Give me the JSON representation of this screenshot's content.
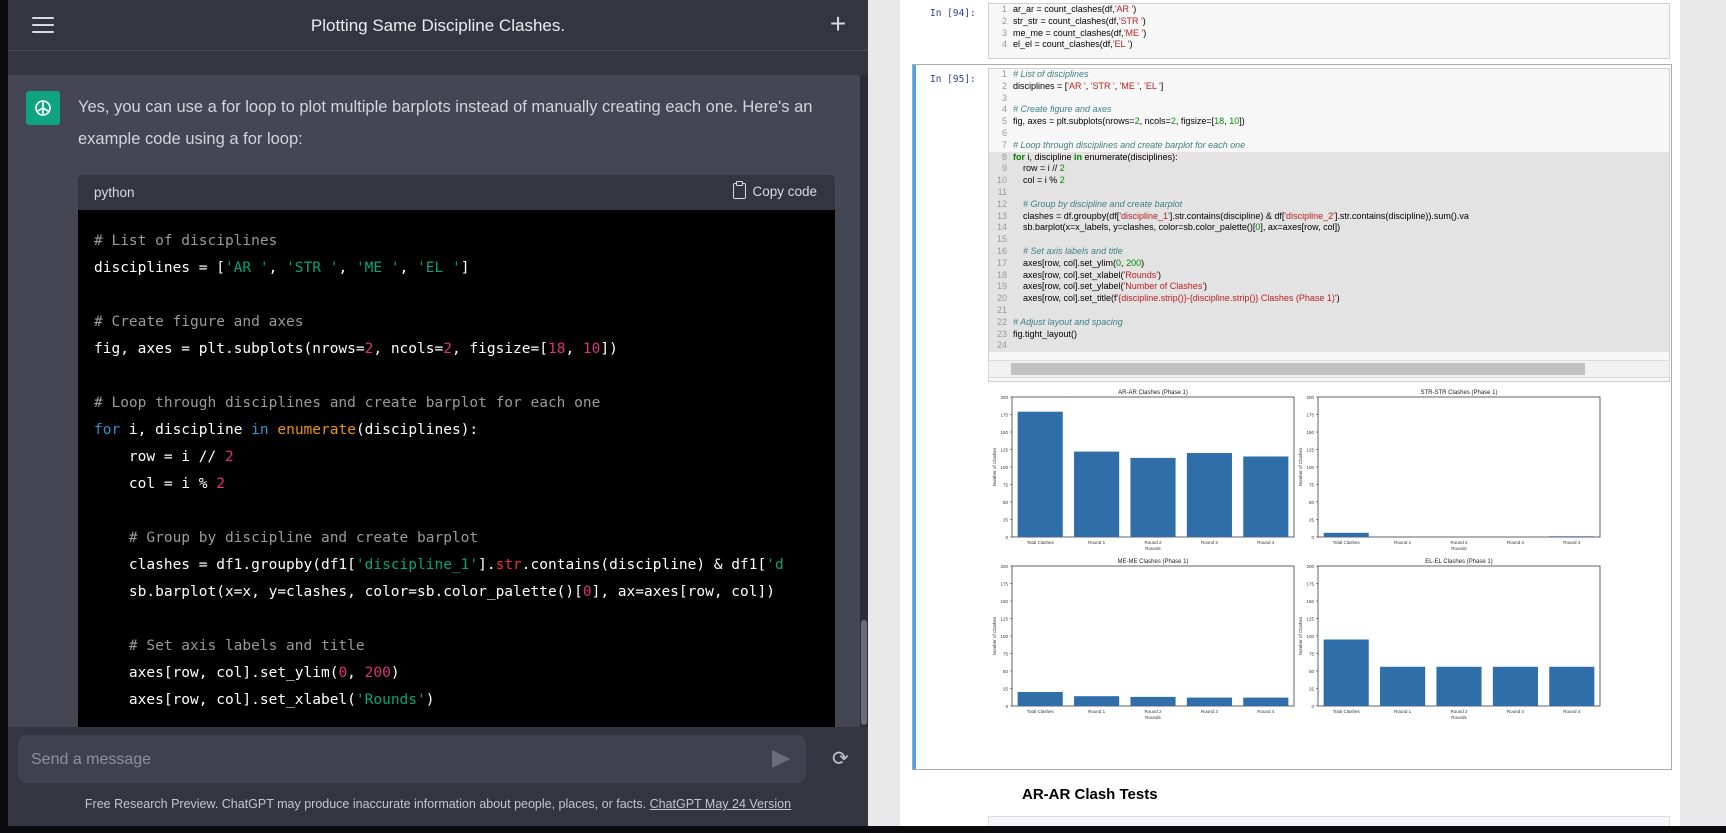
{
  "chat": {
    "title": "Plotting Same Discipline Clashes.",
    "message": "Yes, you can use a for loop to plot multiple barplots instead of manually creating each one. Here's an example code using a for loop:",
    "code_lang": "python",
    "copy_label": "Copy code",
    "input_placeholder": "Send a message",
    "footer_text": "Free Research Preview. ChatGPT may produce inaccurate information about people, places, or facts. ",
    "footer_link": "ChatGPT May 24 Version"
  },
  "notebook": {
    "cell94_prompt": "In [94]:",
    "cell95_prompt": "In [95]:",
    "section_title": "AR-AR Clash Tests"
  },
  "chart_data": [
    {
      "type": "bar",
      "title": "AR-AR Clashes (Phase 1)",
      "categories": [
        "Total Clashes",
        "Round 1",
        "Round 2",
        "Round 3",
        "Round 4"
      ],
      "values": [
        179,
        122,
        113,
        120,
        115
      ],
      "xlabel": "Rounds",
      "ylabel": "Number of Clashes",
      "ylim": [
        0,
        200
      ],
      "yticks": [
        "0",
        "25",
        "50",
        "75",
        "100",
        "125",
        "150",
        "175",
        "200"
      ],
      "color": "#2f6ea8"
    },
    {
      "type": "bar",
      "title": "STR-STR Clashes (Phase 1)",
      "categories": [
        "Total Clashes",
        "Round 1",
        "Round 2",
        "Round 3",
        "Round 4"
      ],
      "values": [
        6,
        0,
        0,
        0,
        1
      ],
      "xlabel": "Rounds",
      "ylabel": "Number of Clashes",
      "ylim": [
        0,
        200
      ],
      "yticks": [
        "0",
        "25",
        "50",
        "75",
        "100",
        "125",
        "150",
        "175",
        "200"
      ],
      "color": "#2f6ea8"
    },
    {
      "type": "bar",
      "title": "ME-ME Clashes (Phase 1)",
      "categories": [
        "Total Clashes",
        "Round 1",
        "Round 2",
        "Round 3",
        "Round 4"
      ],
      "values": [
        20,
        14,
        13,
        12,
        12
      ],
      "xlabel": "Rounds",
      "ylabel": "Number of Clashes",
      "ylim": [
        0,
        200
      ],
      "yticks": [
        "0",
        "25",
        "50",
        "75",
        "100",
        "125",
        "150",
        "175",
        "200"
      ],
      "color": "#2f6ea8"
    },
    {
      "type": "bar",
      "title": "EL-EL Clashes (Phase 1)",
      "categories": [
        "Total Clashes",
        "Round 1",
        "Round 2",
        "Round 3",
        "Round 4"
      ],
      "values": [
        95,
        56,
        56,
        56,
        56
      ],
      "xlabel": "Rounds",
      "ylabel": "Number of Clashes",
      "ylim": [
        0,
        200
      ],
      "yticks": [
        "0",
        "25",
        "50",
        "75",
        "100",
        "125",
        "150",
        "175",
        "200"
      ],
      "color": "#2f6ea8"
    }
  ]
}
